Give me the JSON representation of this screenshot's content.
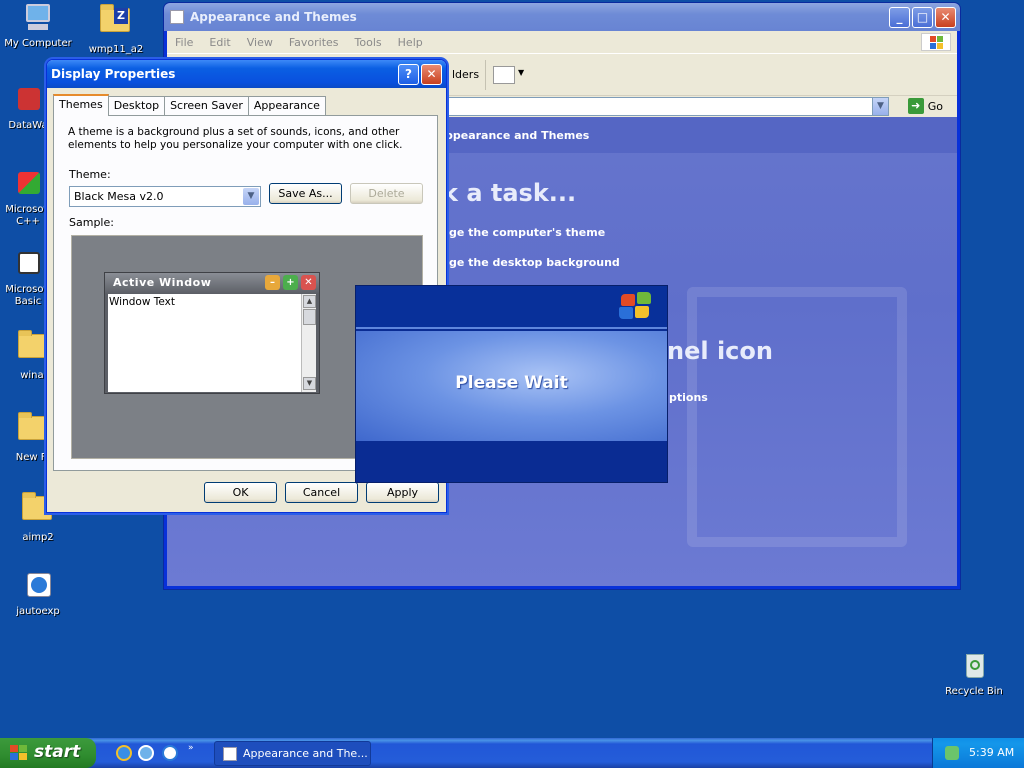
{
  "desktop": {
    "icons": [
      {
        "label": "My Computer"
      },
      {
        "label": "wmp11_a2"
      },
      {
        "label": "DataWa"
      },
      {
        "label": "Microsoft C++"
      },
      {
        "label": "Microsoft Basic"
      },
      {
        "label": "winar"
      },
      {
        "label": "New Fo"
      },
      {
        "label": "aimp2"
      },
      {
        "label": "jautoexp"
      },
      {
        "label": "Recycle Bin"
      }
    ]
  },
  "explorer": {
    "title": "Appearance and Themes",
    "menu": [
      "File",
      "Edit",
      "View",
      "Favorites",
      "Tools",
      "Help"
    ],
    "toolbar": {
      "folders_label": "lders"
    },
    "go_label": "Go",
    "content": {
      "header": "ppearance and Themes",
      "pick_task": "k a task...",
      "task1": "ge the computer's theme",
      "task2": "ge the desktop background",
      "panel_icon": "nel icon",
      "options": "ptions"
    }
  },
  "display_properties": {
    "title": "Display Properties",
    "tabs": [
      "Themes",
      "Desktop",
      "Screen Saver",
      "Appearance"
    ],
    "description": "A theme is a background plus a set of sounds, icons, and other elements to help you personalize your computer with one click.",
    "theme_label": "Theme:",
    "theme_value": "Black Mesa v2.0",
    "save_as": "Save As...",
    "delete": "Delete",
    "sample_label": "Sample:",
    "sample": {
      "window_title": "Active Window",
      "window_text": "Window Text"
    },
    "ok": "OK",
    "cancel": "Cancel",
    "apply": "Apply"
  },
  "splash": {
    "message": "Please Wait"
  },
  "taskbar": {
    "start": "start",
    "task_label": "Appearance and The...",
    "clock": "5:39 AM"
  },
  "colors": {
    "desktop": "#0e4ea6",
    "dialog_title": "#0a4bc6",
    "taskbar": "#245dd9",
    "start_green": "#2f8c2f"
  }
}
